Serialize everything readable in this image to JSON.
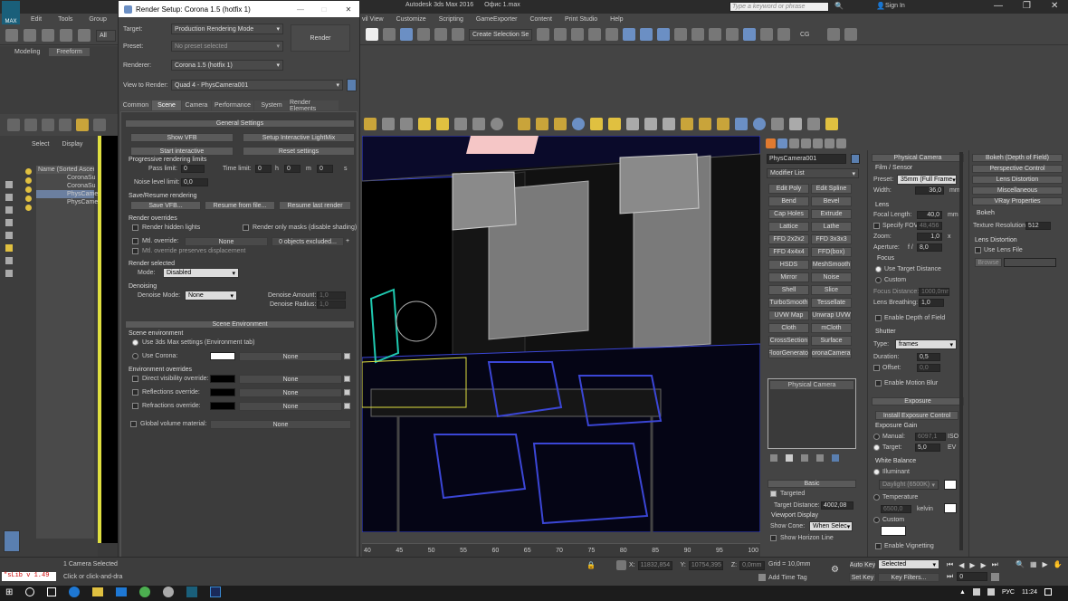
{
  "app": {
    "title": "Autodesk 3ds Max 2016",
    "file": "Офис 1.max",
    "search_placeholder": "Type a keyword or phrase",
    "sign_in": "Sign In"
  },
  "menu": {
    "left": [
      "Edit",
      "Tools",
      "Group"
    ],
    "right": [
      "vil View",
      "Customize",
      "Scripting",
      "GameExporter",
      "Content",
      "Print Studio",
      "Help"
    ]
  },
  "toolbar": {
    "filter": "All",
    "selection_set": "Create Selection Se",
    "cg": "CG"
  },
  "ribbon": {
    "tabs": [
      "Modeling",
      "Freeform"
    ]
  },
  "scene_explorer": {
    "tabs": [
      "Select",
      "Display"
    ],
    "header": "Name (Sorted Ascen",
    "items": [
      "CoronaSu",
      "CoronaSu",
      "PhysCame",
      "PhysCame"
    ]
  },
  "render_setup": {
    "title": "Render Setup: Corona 1.5 (hotfix 1)",
    "target_label": "Target:",
    "target_value": "Production Rendering Mode",
    "preset_label": "Preset:",
    "preset_value": "No preset selected",
    "renderer_label": "Renderer:",
    "renderer_value": "Corona 1.5 (hotfix 1)",
    "view_label": "View to Render:",
    "view_value": "Quad 4 - PhysCamera001",
    "render_button": "Render",
    "tabs": [
      "Common",
      "Scene",
      "Camera",
      "Performance",
      "System",
      "Render Elements"
    ],
    "general_settings": {
      "header": "General Settings",
      "show_vfb": "Show VFB",
      "setup_lightmix": "Setup Interactive LightMix",
      "start_interactive": "Start interactive",
      "reset_settings": "Reset settings",
      "progressive_group": "Progressive rendering limits",
      "pass_limit_label": "Pass limit:",
      "pass_limit": "0",
      "time_limit_label": "Time limit:",
      "time_h": "0",
      "time_m": "0",
      "time_s": "0",
      "h": "h",
      "m": "m",
      "s": "s",
      "noise_label": "Noise level limit:",
      "noise": "0,0",
      "save_group": "Save/Resume rendering",
      "save_vfb": "Save VFB...",
      "resume_file": "Resume from file...",
      "resume_last": "Resume last render",
      "overrides_group": "Render overrides",
      "render_hidden": "Render hidden lights",
      "render_masks": "Render only masks (disable shading)",
      "mtl_override": "Mtl. override:",
      "mtl_none": "None",
      "objects_excluded": "0 objects excluded...",
      "mtl_displacement": "Mtl. override preserves displacement",
      "render_selected_group": "Render selected",
      "mode_label": "Mode:",
      "mode_value": "Disabled",
      "denoising_group": "Denoising",
      "denoise_mode_label": "Denoise Mode:",
      "denoise_mode_value": "None",
      "denoise_amount_label": "Denoise Amount:",
      "denoise_amount": "1,0",
      "denoise_radius_label": "Denoise Radius:",
      "denoise_radius": "1,0"
    },
    "scene_environment": {
      "header": "Scene Environment",
      "group": "Scene environment",
      "use_max": "Use 3ds Max settings (Environment tab)",
      "use_corona": "Use Corona:",
      "none": "None",
      "overrides_group": "Environment overrides",
      "direct": "Direct visibility override:",
      "reflections": "Reflections override:",
      "refractions": "Refractions override:",
      "global_material": "Global volume material:"
    }
  },
  "command_panel": {
    "object_name": "PhysCamera001",
    "modifier_list": "Modifier List",
    "modifiers": [
      [
        "Edit Poly",
        "Edit Spline"
      ],
      [
        "Bend",
        "Bevel"
      ],
      [
        "Cap Holes",
        "Extrude"
      ],
      [
        "Lattice",
        "Lathe"
      ],
      [
        "FFD 2x2x2",
        "FFD 3x3x3"
      ],
      [
        "FFD 4x4x4",
        "FFD(box)"
      ],
      [
        "HSDS",
        "MeshSmooth"
      ],
      [
        "Mirror",
        "Noise"
      ],
      [
        "Shell",
        "Slice"
      ],
      [
        "TurboSmooth",
        "Tessellate"
      ],
      [
        "UVW Map",
        "Unwrap UVW"
      ],
      [
        "Cloth",
        "mCloth"
      ],
      [
        "CrossSection",
        "Surface"
      ],
      [
        "FloorGenerator",
        "CoronaCameraM"
      ]
    ],
    "stack_item": "Physical Camera",
    "basic": {
      "header": "Basic",
      "targeted": "Targeted",
      "target_distance_label": "Target Distance:",
      "target_distance": "4002,08",
      "viewport_display": "Viewport Display",
      "show_cone_label": "Show Cone:",
      "show_cone": "When Selec",
      "show_horizon": "Show Horizon Line"
    }
  },
  "physical_camera": {
    "header": "Physical Camera",
    "film_sensor": "Film / Sensor",
    "preset_label": "Preset:",
    "preset": "35mm (Full Frame",
    "width_label": "Width:",
    "width": "36,0",
    "mm": "mm",
    "lens_group": "Lens",
    "focal_label": "Focal Length:",
    "focal": "40,0",
    "specify_fov": "Specify FOV:",
    "fov": "48,456",
    "zoom_label": "Zoom:",
    "zoom": "1,0",
    "x": "x",
    "aperture_label": "Aperture:",
    "f": "f /",
    "aperture": "8,0",
    "focus_group": "Focus",
    "use_target": "Use Target Distance",
    "custom": "Custom",
    "focus_distance_label": "Focus Distance:",
    "focus_distance": "1000,0mm",
    "lens_breathing_label": "Lens Breathing:",
    "lens_breathing": "1,0",
    "enable_dof": "Enable Depth of Field",
    "shutter_group": "Shutter",
    "type_label": "Type:",
    "type": "frames",
    "duration_label": "Duration:",
    "duration": "0,5",
    "offset_label": "Offset:",
    "offset": "0,0",
    "enable_motion_blur": "Enable Motion Blur",
    "exposure_header": "Exposure",
    "install_exposure": "Install Exposure Control",
    "exposure_gain": "Exposure Gain",
    "manual_label": "Manual:",
    "manual": "6097,1",
    "iso": "ISO",
    "target_label": "Target:",
    "target": "5,0",
    "ev": "EV",
    "white_balance": "White Balance",
    "illuminant": "Illuminant",
    "daylight": "Daylight (6500K)",
    "temperature": "Temperature",
    "temperature_value": "6500,0",
    "kelvin": "kelvin",
    "custom_wb": "Custom",
    "enable_vignetting": "Enable Vignetting"
  },
  "right_rollouts": {
    "items": [
      "Bokeh (Depth of Field)",
      "Perspective Control",
      "Lens Distortion",
      "Miscellaneous",
      "VRay Properties"
    ],
    "bokeh": "Bokeh",
    "texture_resolution_label": "Texture Resolution",
    "texture_resolution": "512",
    "lens_distortion": "Lens Distortion",
    "use_lens_file": "Use Lens File",
    "browse": "Browse"
  },
  "timeline": {
    "ticks": [
      "40",
      "45",
      "50",
      "55",
      "60",
      "65",
      "70",
      "75",
      "80",
      "85",
      "90",
      "95",
      "100"
    ]
  },
  "status": {
    "script": "\"sLib v 1.49",
    "selected": "1 Camera Selected",
    "prompt": "Click or click-and-dra",
    "x_label": "X:",
    "x": "11832,854",
    "y_label": "Y:",
    "y": "10754,395",
    "z_label": "Z:",
    "z": "0,0mm",
    "grid": "Grid = 10,0mm",
    "add_time_tag": "Add Time Tag",
    "auto_key": "Auto Key",
    "auto_key_value": "Selected",
    "set_key": "Set Key",
    "key_filters": "Key Filters...",
    "frame": "0"
  },
  "taskbar": {
    "lang": "РУС",
    "time": "11:24"
  }
}
